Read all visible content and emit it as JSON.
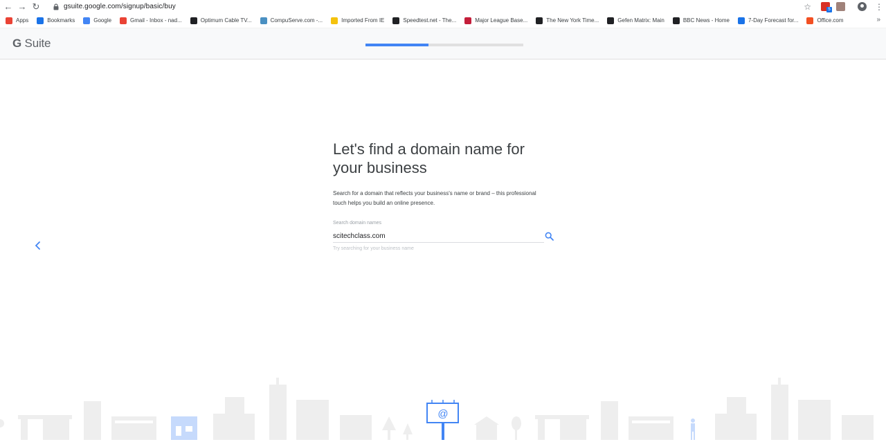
{
  "browser": {
    "url": "gsuite.google.com/signup/basic/buy",
    "bookmarks": [
      {
        "label": "Apps",
        "icon": "apps-grid-icon",
        "color": "#ea4335"
      },
      {
        "label": "Bookmarks",
        "icon": "star-icon",
        "color": "#1a73e8"
      },
      {
        "label": "Google",
        "icon": "google-icon",
        "color": "#4285f4"
      },
      {
        "label": "Gmail - Inbox - nad...",
        "icon": "gmail-icon",
        "color": "#ea4335"
      },
      {
        "label": "Optimum Cable TV...",
        "icon": "optimum-icon",
        "color": "#202124"
      },
      {
        "label": "CompuServe.com -...",
        "icon": "compuserve-icon",
        "color": "#4a90c2"
      },
      {
        "label": "Imported From IE",
        "icon": "folder-icon",
        "color": "#f4c20d"
      },
      {
        "label": "Speedtest.net - The...",
        "icon": "speedtest-icon",
        "color": "#202124"
      },
      {
        "label": "Major League Base...",
        "icon": "mlb-icon",
        "color": "#c41e3a"
      },
      {
        "label": "The New York Time...",
        "icon": "nyt-icon",
        "color": "#202124"
      },
      {
        "label": "Gefen Matrix: Main",
        "icon": "gefen-icon",
        "color": "#202124"
      },
      {
        "label": "BBC News - Home",
        "icon": "bbc-icon",
        "color": "#202124"
      },
      {
        "label": "7-Day Forecast for...",
        "icon": "noaa-icon",
        "color": "#1a73e8"
      },
      {
        "label": "Office.com",
        "icon": "office-icon",
        "color": "#f25022"
      }
    ],
    "extension_badge": "5"
  },
  "header": {
    "logo_g": "G",
    "logo_suite": " Suite",
    "progress": 0.4
  },
  "main": {
    "headline": "Let's find a domain name for your business",
    "description": "Search for a domain that reflects your business's name or brand – this professional touch helps you build an online presence.",
    "search": {
      "label": "Search domain names",
      "value": "scitechclass.com",
      "helper": "Try searching for your business name"
    },
    "billboard_symbol": "@"
  },
  "colors": {
    "accent": "#4285f4",
    "skyline": "#eeeeee",
    "skyline_accent": "#c6dafc"
  }
}
